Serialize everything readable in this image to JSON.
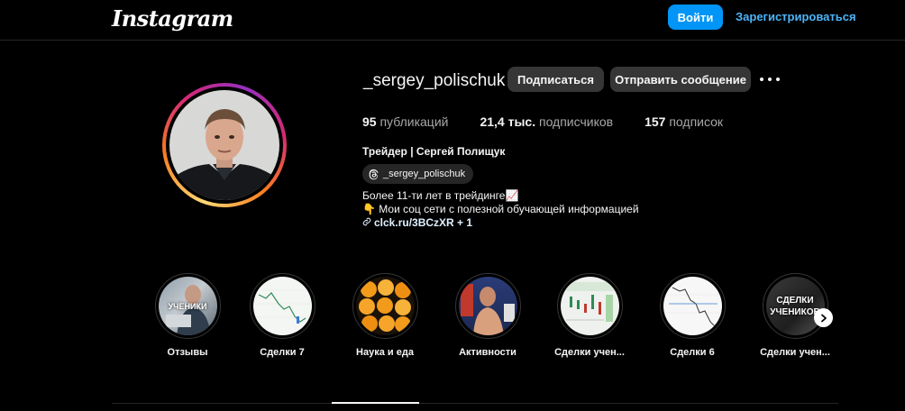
{
  "header": {
    "logo_text": "Instagram",
    "login_label": "Войти",
    "signup_label": "Зарегистрироваться",
    "accent": "#0095f6"
  },
  "profile": {
    "username": "_sergey_polischuk",
    "follow_label": "Подписаться",
    "message_label": "Отправить сообщение",
    "stats": {
      "posts_count": "95",
      "posts_label": "публикаций",
      "followers_count": "21,4 тыс.",
      "followers_label": "подписчиков",
      "following_count": "157",
      "following_label": "подписок"
    },
    "full_name": "Трейдер | Сергей Полищук",
    "threads_handle": "_sergey_polischuk",
    "bio_line1": "Более 11-ти лет в трейдинге📈",
    "bio_line2": "👇 Мои соц сети с полезной обучающей информацией",
    "link_text": "clck.ru/3BCzXR + 1"
  },
  "highlights": [
    {
      "label": "Отзывы",
      "overlay": "УЧЕНИКИ"
    },
    {
      "label": "Сделки 7",
      "overlay": ""
    },
    {
      "label": "Наука и еда",
      "overlay": ""
    },
    {
      "label": "Активности",
      "overlay": ""
    },
    {
      "label": "Сделки учен...",
      "overlay": ""
    },
    {
      "label": "Сделки 6",
      "overlay": ""
    },
    {
      "label": "Сделки учен...",
      "overlay": "СДЕЛКИ УЧЕНИКОВ"
    }
  ]
}
